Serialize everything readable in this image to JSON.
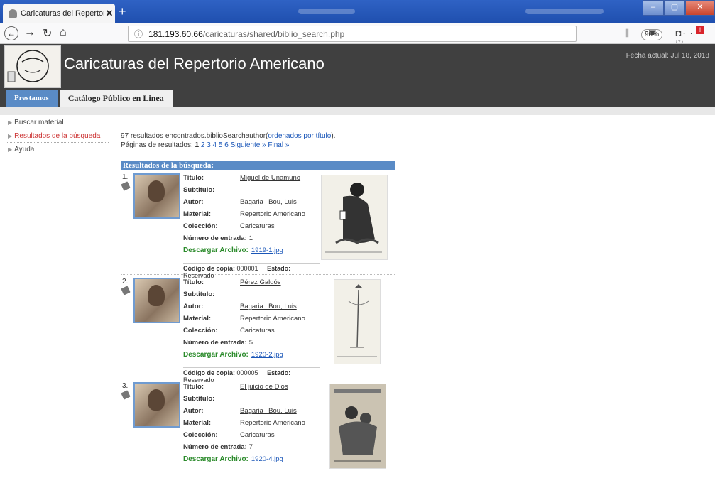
{
  "browser": {
    "tab_title": "Caricaturas del Repertorio Ame",
    "url_host": "181.193.60.66",
    "url_path": "/caricaturas/shared/biblio_search.php",
    "zoom": "90%"
  },
  "header": {
    "site_title": "Caricaturas del Repertorio Americano",
    "date": "Fecha actual: Jul 18, 2018"
  },
  "nav_tabs": [
    "Prestamos",
    "Catálogo Público en Linea"
  ],
  "sidebar": [
    {
      "label": "Buscar material"
    },
    {
      "label": "Resultados de la búsqueda"
    },
    {
      "label": "Ayuda"
    }
  ],
  "summary": {
    "text": "97 resultados encontrados.biblioSearchauthor(",
    "link": "ordenados por título",
    "close": ")."
  },
  "pagination": {
    "label": "Páginas de resultados:",
    "current": "1",
    "pages": [
      "2",
      "3",
      "4",
      "5",
      "6"
    ],
    "next": "Siguiente »",
    "last": "Final »"
  },
  "results_heading": "Resultados de la búsqueda:",
  "labels": {
    "titulo": "Título:",
    "subtitulo": "Subtitulo:",
    "autor": "Autor:",
    "material": "Material:",
    "coleccion": "Colección:",
    "numero": "Número de entrada:",
    "descargar": "Descargar Archivo:",
    "codigo": "Código de copia:",
    "estado": "Estado:"
  },
  "results": [
    {
      "num": "1.",
      "titulo": "Miguel de Unamuno",
      "autor": "Bagaria i Bou, Luis",
      "material": "Repertorio Americano",
      "coleccion": "Caricaturas",
      "numero": "1",
      "archivo": "1919-1.jpg",
      "codigo": "000001",
      "estado": "Reservado"
    },
    {
      "num": "2.",
      "titulo": "Pérez Galdós",
      "autor": "Bagaria i Bou, Luis",
      "material": "Repertorio Americano",
      "coleccion": "Caricaturas",
      "numero": "5",
      "archivo": "1920-2.jpg",
      "codigo": "000005",
      "estado": "Reservado"
    },
    {
      "num": "3.",
      "titulo": "El juicio de Dios",
      "autor": "Bagaria i Bou, Luis",
      "material": "Repertorio Americano",
      "coleccion": "Caricaturas",
      "numero": "7",
      "archivo": "1920-4.jpg",
      "codigo": "",
      "estado": ""
    }
  ]
}
